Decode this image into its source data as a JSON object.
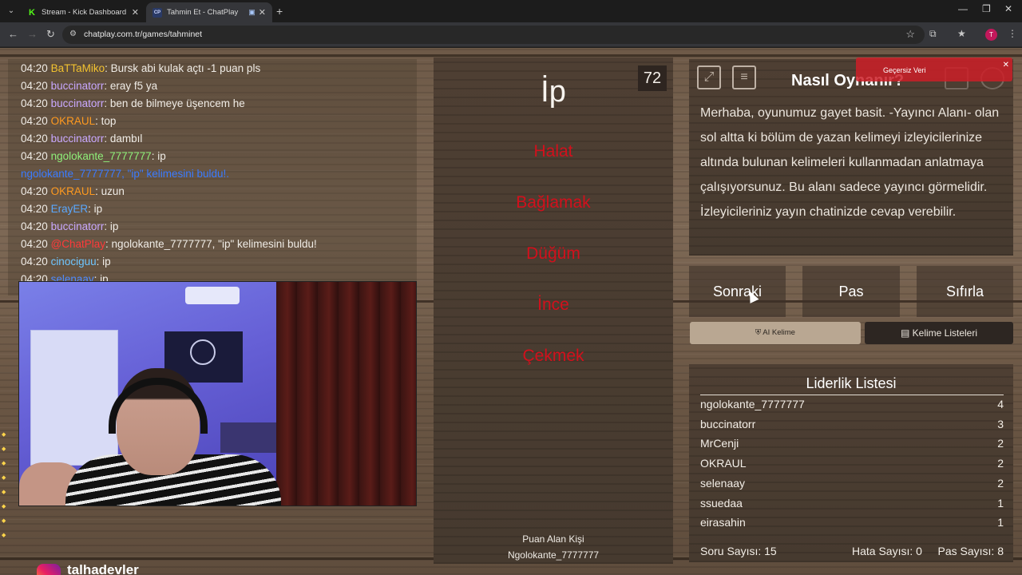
{
  "browser": {
    "tabs": [
      {
        "title": "Stream - Kick Dashboard",
        "favicon": "K"
      },
      {
        "title": "Tahmin Et - ChatPlay",
        "favicon": "CP"
      }
    ],
    "url": "chatplay.com.tr/games/tahminet",
    "profile_initial": "T"
  },
  "chat": {
    "messages": [
      {
        "time": "04:20",
        "user": "BaTTaMiko",
        "user_color": "#f2c230",
        "text": ": Bursk abi kulak açtı -1 puan pls"
      },
      {
        "time": "04:20",
        "user": "buccinatorr",
        "user_color": "#c9a8ff",
        "text": ": eray f5 ya"
      },
      {
        "time": "04:20",
        "user": "buccinatorr",
        "user_color": "#c9a8ff",
        "text": ": ben de bilmeye üşencem he"
      },
      {
        "time": "04:20",
        "user": "OKRAUL",
        "user_color": "#ff9a1f",
        "text": ": top"
      },
      {
        "time": "04:20",
        "user": "buccinatorr",
        "user_color": "#c9a8ff",
        "text": ": dambıl"
      },
      {
        "time": "04:20",
        "user": "ngolokante_7777777",
        "user_color": "#8ff07a",
        "text": ": ip"
      },
      {
        "time": "",
        "user": "ngolokante_7777777,",
        "user_color": "#3b7bff",
        "text": " \"ip\" kelimesini buldu!."
      },
      {
        "time": "04:20",
        "user": "OKRAUL",
        "user_color": "#ff9a1f",
        "text": ": uzun"
      },
      {
        "time": "04:20",
        "user": "ErayER",
        "user_color": "#5aa8ff",
        "text": ": ip"
      },
      {
        "time": "04:20",
        "user": "buccinatorr",
        "user_color": "#c9a8ff",
        "text": ": ip"
      },
      {
        "time": "04:20",
        "user": "@ChatPlay",
        "user_color": "#ff3a3a",
        "text": ": ngolokante_7777777, \"ip\" kelimesini buldu!"
      },
      {
        "time": "04:20",
        "user": "cinociguu",
        "user_color": "#6ec6ff",
        "text": ": ip"
      },
      {
        "time": "04:20",
        "user": "selenaay",
        "user_color": "#4f8cff",
        "text": ": ip"
      }
    ]
  },
  "social": {
    "handle": "talhadevler"
  },
  "game": {
    "timer": "72",
    "word": "İp",
    "banned_words": [
      "Halat",
      "Bağlamak",
      "Düğüm",
      "İnce",
      "Çekmek"
    ],
    "scorer_label": "Puan Alan Kişi",
    "scorer_name": "Ngolokante_7777777"
  },
  "how_to_play": {
    "title": "Nasıl Oynanır?",
    "text": "Merhaba, oyunumuz gayet basit. -Yayıncı Alanı- olan sol altta ki bölüm de yazan kelimeyi izleyicilerinize altında bulunan kelimeleri kullanmadan anlatmaya çalışıyorsunuz. Bu alanı sadece yayıncı görmelidir. İzleyicileriniz yayın chatinizde cevap verebilir."
  },
  "toast": {
    "message": "Geçersiz Veri"
  },
  "actions": {
    "next": "Sonraki",
    "pass": "Pas",
    "reset": "Sıfırla"
  },
  "tools": {
    "ai_word": "AI Kelime",
    "word_lists": "Kelime Listeleri"
  },
  "leaderboard": {
    "title": "Liderlik Listesi",
    "rows": [
      {
        "name": "ngolokante_7777777",
        "score": "4"
      },
      {
        "name": "buccinatorr",
        "score": "3"
      },
      {
        "name": "MrCenji",
        "score": "2"
      },
      {
        "name": "OKRAUL",
        "score": "2"
      },
      {
        "name": "selenaay",
        "score": "2"
      },
      {
        "name": "ssuedaa",
        "score": "1"
      },
      {
        "name": "eirasahin",
        "score": "1"
      }
    ],
    "questions": "Soru Sayısı: 15",
    "errors": "Hata Sayısı: 0",
    "passes": "Pas Sayısı: 8"
  }
}
